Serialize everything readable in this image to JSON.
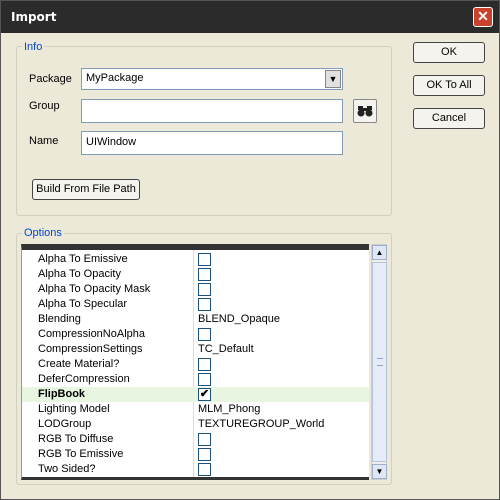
{
  "window": {
    "title": "Import",
    "close": "✕"
  },
  "info": {
    "legend": "Info",
    "package_label": "Package",
    "package_value": "MyPackage",
    "group_label": "Group",
    "group_value": "",
    "name_label": "Name",
    "name_value": "UIWindow",
    "build_button": "Build From File Path"
  },
  "options": {
    "legend": "Options",
    "rows": [
      {
        "name": "Alpha To Emissive",
        "type": "checkbox",
        "checked": false
      },
      {
        "name": "Alpha To Opacity",
        "type": "checkbox",
        "checked": false
      },
      {
        "name": "Alpha To Opacity Mask",
        "type": "checkbox",
        "checked": false
      },
      {
        "name": "Alpha To Specular",
        "type": "checkbox",
        "checked": false
      },
      {
        "name": "Blending",
        "type": "text",
        "value": "BLEND_Opaque"
      },
      {
        "name": "CompressionNoAlpha",
        "type": "checkbox",
        "checked": false
      },
      {
        "name": "CompressionSettings",
        "type": "text",
        "value": "TC_Default"
      },
      {
        "name": "Create Material?",
        "type": "checkbox",
        "checked": false
      },
      {
        "name": "DeferCompression",
        "type": "checkbox",
        "checked": false
      },
      {
        "name": "FlipBook",
        "type": "checkbox",
        "checked": true,
        "selected": true
      },
      {
        "name": "Lighting Model",
        "type": "text",
        "value": "MLM_Phong"
      },
      {
        "name": "LODGroup",
        "type": "text",
        "value": "TEXTUREGROUP_World"
      },
      {
        "name": "RGB To Diffuse",
        "type": "checkbox",
        "checked": false
      },
      {
        "name": "RGB To Emissive",
        "type": "checkbox",
        "checked": false
      },
      {
        "name": "Two Sided?",
        "type": "checkbox",
        "checked": false
      }
    ]
  },
  "buttons": {
    "ok": "OK",
    "ok_to_all": "OK To All",
    "cancel": "Cancel"
  },
  "icons": {
    "find": "binoculars-icon",
    "dropdown": "chevron-down-icon",
    "check": "check-icon"
  }
}
